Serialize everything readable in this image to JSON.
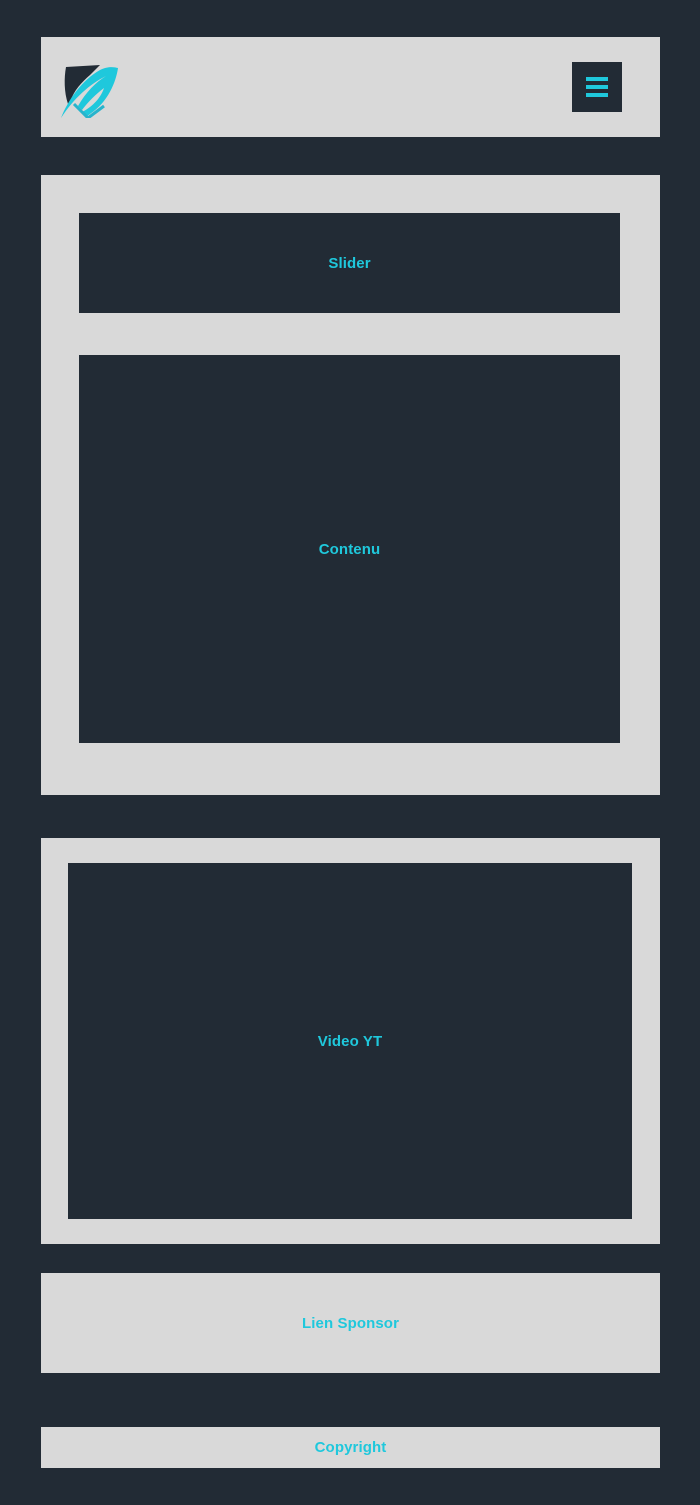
{
  "header": {
    "logo_name": "shield-feather-logo",
    "menu_icon": "hamburger-menu-icon"
  },
  "main": {
    "slider_label": "Slider",
    "content_label": "Contenu"
  },
  "video": {
    "label": "Video YT"
  },
  "sponsor": {
    "link_label": "Lien Sponsor"
  },
  "footer": {
    "copyright": "Copyright"
  },
  "colors": {
    "background": "#222b35",
    "panel": "#d9d9d9",
    "accent": "#1fc8dc"
  }
}
